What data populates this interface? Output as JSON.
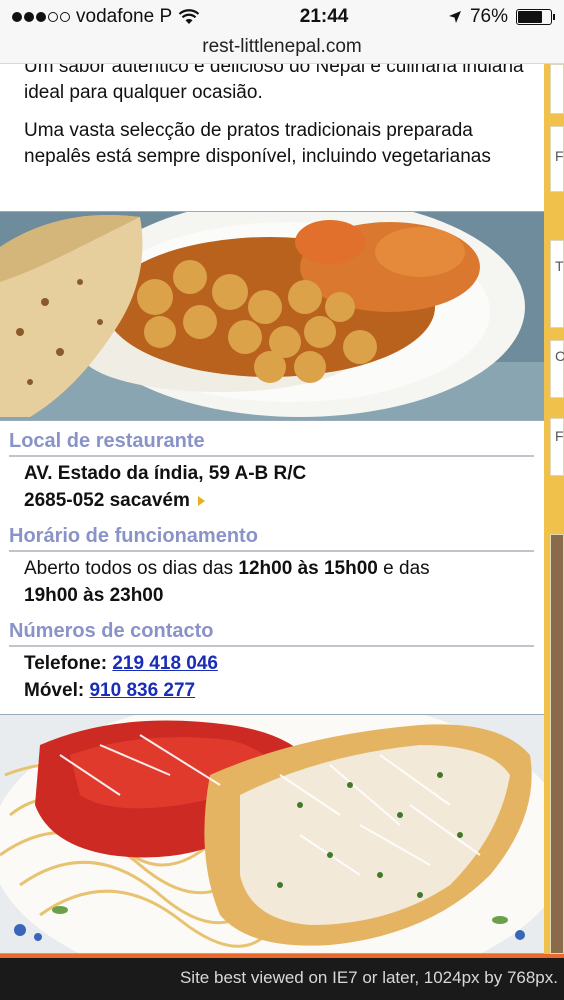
{
  "status": {
    "carrier": "vodafone P",
    "time": "21:44",
    "battery": "76%",
    "battery_level": 0.76
  },
  "browser": {
    "url": "rest-littlenepal.com"
  },
  "intro": {
    "p1": "Um sabor autêntico e delicioso do Nepal e culinária indiana ideal para qualquer ocasião.",
    "p2": "Uma vasta selecção de pratos tradicionais preparada nepalês está sempre disponível, incluindo vegetarianas"
  },
  "location": {
    "title": "Local de restaurante",
    "line1": "AV. Estado da índia, 59 A-B R/C",
    "line2": "2685-052 sacavém"
  },
  "hours": {
    "title": "Horário de funcionamento",
    "pre": "Aberto todos os dias das ",
    "h1": "12h00 às 15h00",
    "mid": " e das",
    "h2": "19h00 às 23h00"
  },
  "contact": {
    "title": "Números de contacto",
    "phone_label": "Telefone:",
    "phone": "219 418 046",
    "mobile_label": "Móvel:",
    "mobile": "910 836 277"
  },
  "sidebar": {
    "letters": [
      "F",
      "T",
      "C",
      "F"
    ]
  },
  "footer": {
    "text": "Site best viewed on IE7 or later, 1024px by 768px."
  }
}
